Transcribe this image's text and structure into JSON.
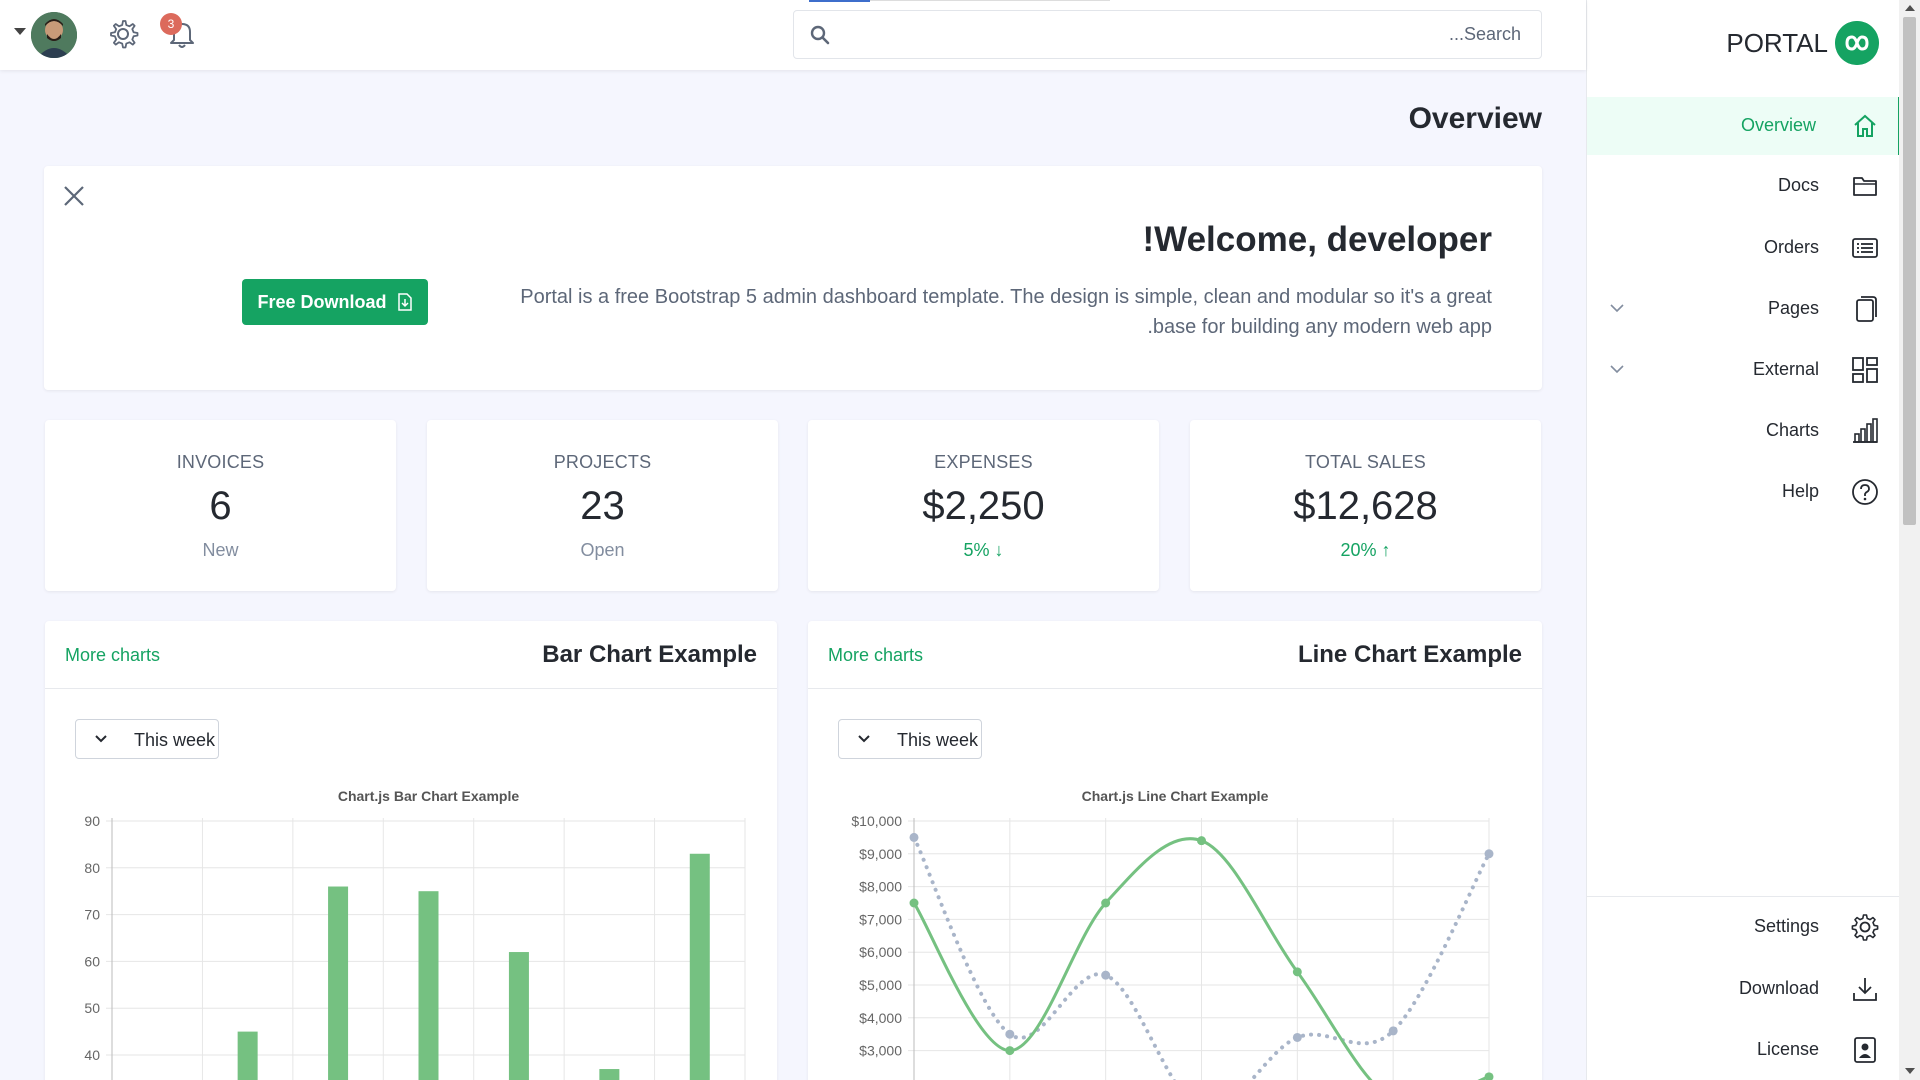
{
  "topbar": {
    "notification_count": "3",
    "search_placeholder": "...Search"
  },
  "page": {
    "title": "Overview"
  },
  "welcome": {
    "title": "!Welcome, developer",
    "text": "Portal is a free Bootstrap 5 admin dashboard template. The design is simple, clean and modular so it's a great base for building any modern web app.",
    "text_line1": "Portal is a free Bootstrap 5 admin dashboard template. The design is simple, clean and modular so it's a great",
    "text_line2": ".base for building any modern web app",
    "button_label": "Free Download"
  },
  "stats": [
    {
      "label": "INVOICES",
      "value": "6",
      "sub": "New"
    },
    {
      "label": "PROJECTS",
      "value": "23",
      "sub": "Open"
    },
    {
      "label": "EXPENSES",
      "value": "$2,250",
      "sub": "5% ↓"
    },
    {
      "label": "TOTAL SALES",
      "value": "$12,628",
      "sub": "20% ↑"
    }
  ],
  "bar_card": {
    "link": "More charts",
    "title": "Bar Chart Example",
    "week_select": "This week"
  },
  "line_card": {
    "link": "More charts",
    "title": "Line Chart Example",
    "week_select": "This week"
  },
  "sidebar": {
    "brand": "PORTAL",
    "items": [
      {
        "label": "Overview",
        "icon": "house-icon",
        "active": true
      },
      {
        "label": "Docs",
        "icon": "folder-icon"
      },
      {
        "label": "Orders",
        "icon": "list-icon"
      },
      {
        "label": "Pages",
        "icon": "pages-icon",
        "expandable": true
      },
      {
        "label": "External",
        "icon": "grid-icon",
        "expandable": true
      },
      {
        "label": "Charts",
        "icon": "bar-chart-icon"
      },
      {
        "label": "Help",
        "icon": "question-icon"
      }
    ],
    "footer_items": [
      {
        "label": "Settings",
        "icon": "gear-icon"
      },
      {
        "label": "Download",
        "icon": "download-icon"
      },
      {
        "label": "License",
        "icon": "license-icon"
      }
    ]
  },
  "colors": {
    "accent": "#15a362",
    "chart_green": "#75c181",
    "chart_gray": "#a9b5c9",
    "badge": "#dc6a5c"
  },
  "chart_data": [
    {
      "type": "bar",
      "title": "Chart.js Bar Chart Example",
      "categories": [
        "",
        "",
        "",
        "",
        "",
        "",
        ""
      ],
      "series": [
        {
          "values": [
            45,
            76,
            75,
            62,
            37,
            83
          ]
        }
      ],
      "y_ticks": [
        "90",
        "80",
        "70",
        "60",
        "50",
        "40"
      ],
      "ylim": [
        40,
        90
      ],
      "grid": true
    },
    {
      "type": "line",
      "title": "Chart.js Line Chart Example",
      "y_ticks": [
        "$10,000",
        "$9,000",
        "$8,000",
        "$7,000",
        "$6,000",
        "$5,000",
        "$4,000",
        "$3,000"
      ],
      "ylim": [
        3000,
        10000
      ],
      "grid": true,
      "series": [
        {
          "style": "solid",
          "color": "#75c181",
          "values": [
            7500,
            3000,
            7500,
            9400,
            5400,
            1500,
            2200
          ]
        },
        {
          "style": "dotted",
          "color": "#a9b5c9",
          "values": [
            9500,
            3500,
            5300,
            1200,
            3400,
            3600,
            9000
          ]
        }
      ]
    }
  ]
}
